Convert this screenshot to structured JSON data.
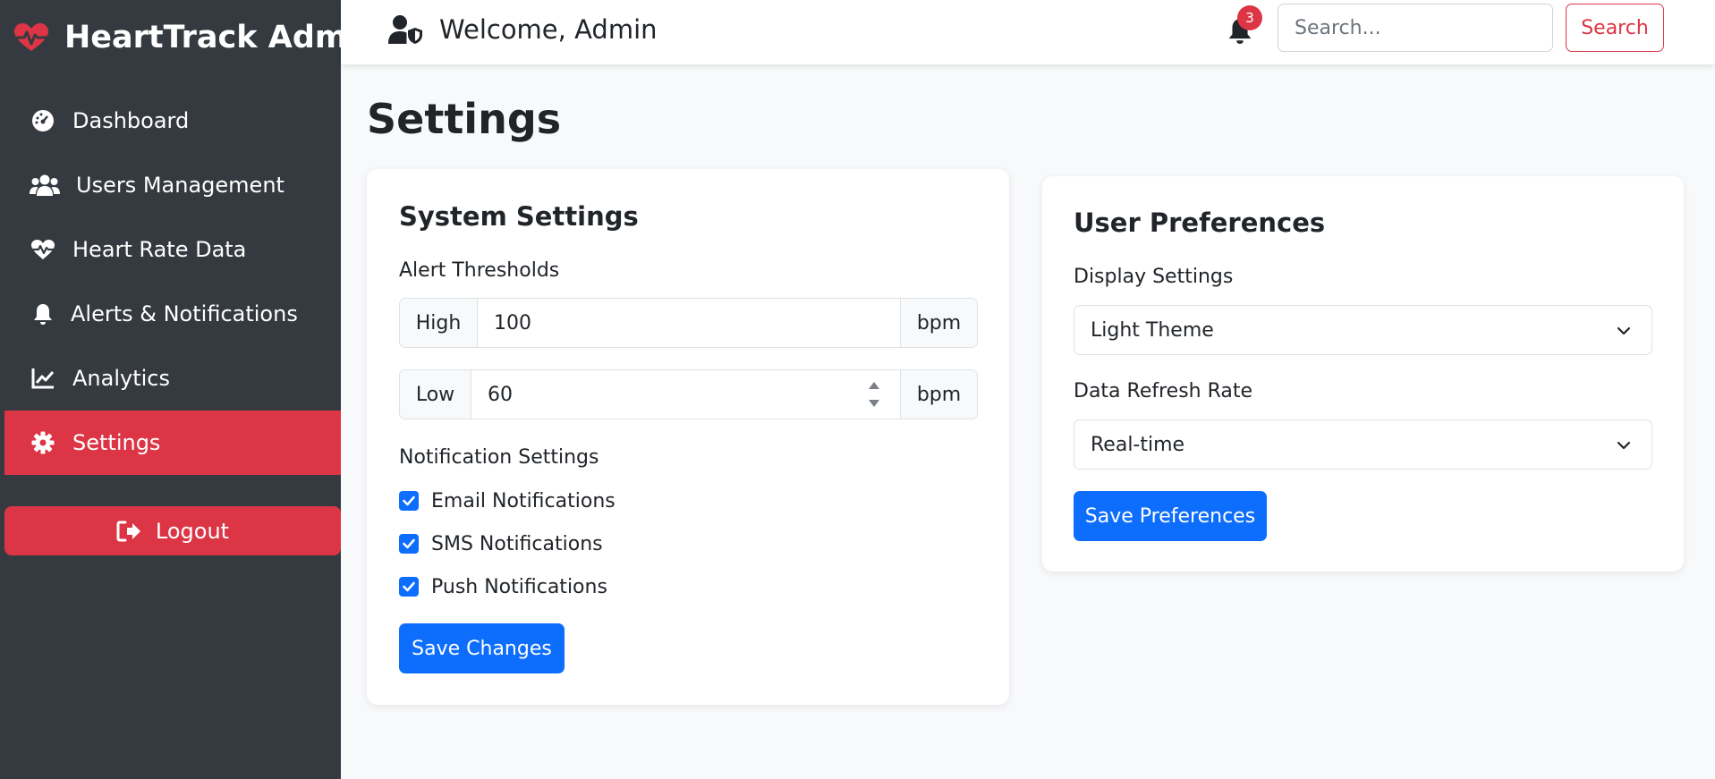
{
  "sidebar": {
    "brand": {
      "title": "HeartTrack Admin",
      "icon": "heart-pulse-icon",
      "icon_color": "#dc3545"
    },
    "items": [
      {
        "label": "Dashboard",
        "icon": "tachometer-icon",
        "active": false
      },
      {
        "label": "Users Management",
        "icon": "users-icon",
        "active": false
      },
      {
        "label": "Heart Rate Data",
        "icon": "heartbeat-icon",
        "active": false
      },
      {
        "label": "Alerts & Notifications",
        "icon": "bell-icon",
        "active": false
      },
      {
        "label": "Analytics",
        "icon": "line-chart-icon",
        "active": false
      },
      {
        "label": "Settings",
        "icon": "gear-icon",
        "active": true
      }
    ],
    "logout_label": "Logout"
  },
  "header": {
    "welcome_text": "Welcome, Admin",
    "notification_count": "3",
    "search_placeholder": "Search...",
    "search_button": "Search"
  },
  "page": {
    "title": "Settings"
  },
  "system_settings": {
    "title": "System Settings",
    "thresholds_label": "Alert Thresholds",
    "high": {
      "label": "High",
      "value": "100",
      "unit": "bpm"
    },
    "low": {
      "label": "Low",
      "value": "60",
      "unit": "bpm"
    },
    "notifications_label": "Notification Settings",
    "notifications": [
      {
        "label": "Email Notifications",
        "checked": true
      },
      {
        "label": "SMS Notifications",
        "checked": true
      },
      {
        "label": "Push Notifications",
        "checked": true
      }
    ],
    "save_button": "Save Changes"
  },
  "user_preferences": {
    "title": "User Preferences",
    "display_label": "Display Settings",
    "display_value": "Light Theme",
    "refresh_label": "Data Refresh Rate",
    "refresh_value": "Real-time",
    "save_button": "Save Preferences"
  },
  "colors": {
    "sidebar_bg": "#343a40",
    "accent_red": "#dc3545",
    "primary_blue": "#0d6efd",
    "page_bg": "#f8f9fa"
  }
}
